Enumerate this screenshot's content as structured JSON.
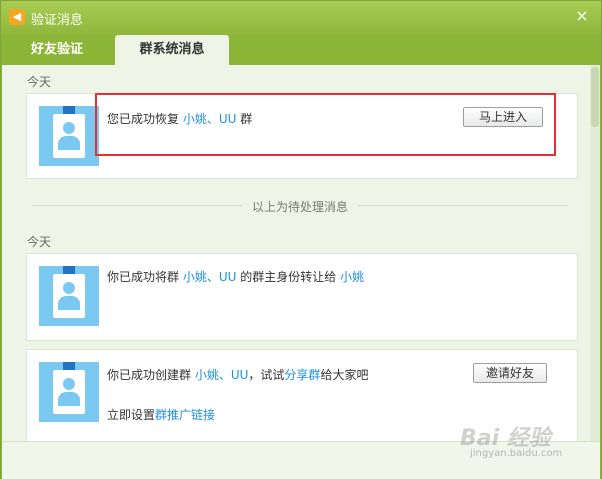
{
  "window": {
    "title": "验证消息",
    "close": "×"
  },
  "tabs": [
    {
      "label": "好友验证"
    },
    {
      "label": "群系统消息"
    }
  ],
  "sections": {
    "today1": "今天",
    "today2": "今天",
    "divider": "以上为待处理消息"
  },
  "card1": {
    "prefix": "您已成功恢复 ",
    "group_name": "小姚、UU",
    "suffix": " 群",
    "button": "马上进入"
  },
  "card2": {
    "prefix": "你已成功将群 ",
    "group_name": "小姚、UU",
    "middle": " 的群主身份转让给 ",
    "user": "小姚"
  },
  "card3": {
    "prefix": "你已成功创建群 ",
    "group_name": "小姚、UU",
    "middle": "，试试",
    "share_link": "分享群",
    "suffix": "给大家吧",
    "button": "邀请好友",
    "promo_prefix": "立即设置",
    "promo_link": "群推广链接"
  },
  "watermark": {
    "main": "Bai 经验",
    "sub": "jingyan.baidu.com"
  },
  "colors": {
    "accent": "#8bb537",
    "link": "#1f8ee3",
    "highlight": "#e53030"
  }
}
